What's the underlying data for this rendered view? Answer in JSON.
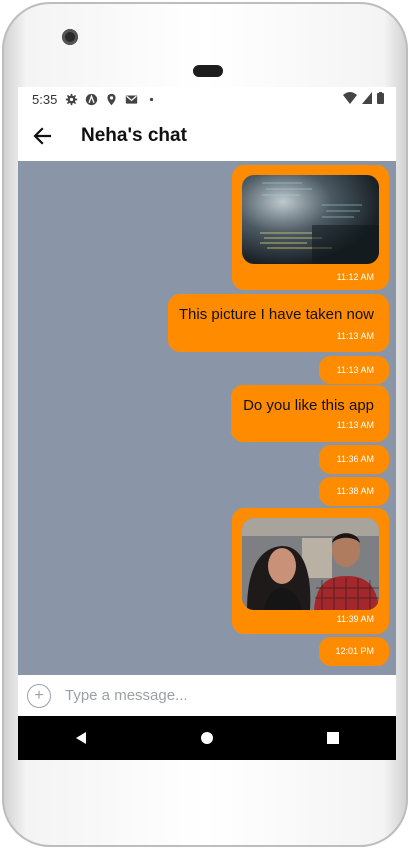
{
  "status_bar": {
    "time": "5:35",
    "icons_left": [
      "gear-icon",
      "app-icon",
      "location-icon",
      "gmail-icon",
      "dot-icon"
    ],
    "icons_right": [
      "wifi-icon",
      "signal-icon",
      "battery-icon"
    ]
  },
  "app_bar": {
    "title": "Neha's chat",
    "back_icon": "arrow-back-icon"
  },
  "messages": [
    {
      "type": "image",
      "time": "11:12 AM",
      "image": "code-screen-photo"
    },
    {
      "type": "text",
      "text": "This picture I have taken now",
      "time": "11:13 AM"
    },
    {
      "type": "time-only",
      "time": "11:13 AM"
    },
    {
      "type": "text",
      "text": "Do you like this app",
      "time": "11:13 AM"
    },
    {
      "type": "time-only",
      "time": "11:36 AM"
    },
    {
      "type": "time-only",
      "time": "11:38 AM"
    },
    {
      "type": "image",
      "time": "11:39 AM",
      "image": "couple-selfie-photo"
    },
    {
      "type": "time-only",
      "time": "12:01 PM"
    }
  ],
  "input": {
    "placeholder": "Type a message..."
  },
  "colors": {
    "bubble": "#ff8c00",
    "chat_background": "#8a96a8"
  }
}
